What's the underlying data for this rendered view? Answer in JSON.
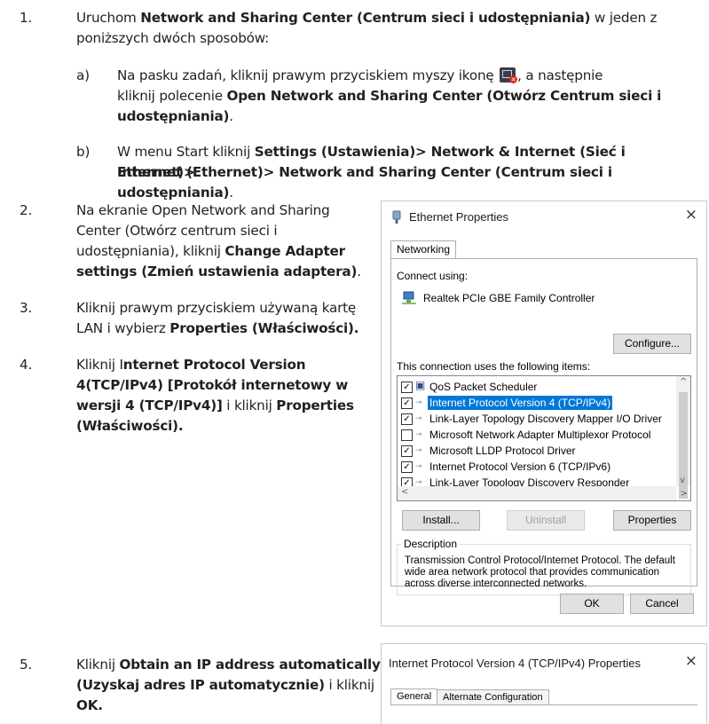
{
  "step1": {
    "num": "1.",
    "pre": "Uruchom ",
    "bold": "Network and Sharing Center (Centrum sieci i udostępniania)",
    "post": " w jeden z",
    "line2": "poniższych dwóch sposobów:"
  },
  "step1a": {
    "label": "a)",
    "pre": "Na pasku zadań, kliknij prawym przyciskiem myszy ikonę ",
    "post": ", a następnie",
    "line2_pre": "kliknij polecenie ",
    "line2_bold": "Open Network and Sharing Center (Otwórz Centrum sieci i",
    "line3_bold": "udostępniania)",
    "line3_post": "."
  },
  "step1b": {
    "label": "b)",
    "pre": "W menu Start kliknij ",
    "bold1": "Settings (Ustawienia)> Network & Internet (Sieć i Internet)>",
    "bold2": "Ethernet (Ethernet)> Network and Sharing Center (Centrum sieci i udostępniania)",
    "post": "."
  },
  "step2": {
    "num": "2.",
    "line1": "Na ekranie Open Network and Sharing",
    "line2": "Center (Otwórz centrum sieci i",
    "line3_pre": "udostępniania), kliknij ",
    "line3_bold": "Change Adapter",
    "line4_bold": "settings (Zmień ustawienia adaptera)",
    "line4_post": "."
  },
  "step3": {
    "num": "3.",
    "line1": "Kliknij prawym przyciskiem używaną kartę",
    "line2_pre": "LAN i wybierz ",
    "line2_bold": "Properties (Właściwości)."
  },
  "step4": {
    "num": "4.",
    "line1_pre": "Kliknij I",
    "line1_bold": "nternet Protocol Version",
    "line2_bold": "4(TCP/IPv4) [Protokół internetowy w",
    "line3_bold": "wersji 4 (TCP/IPv4)]",
    "line3_mid": " i kliknij ",
    "line3_bold2": "Properties",
    "line4_bold": "(Właściwości)."
  },
  "step5": {
    "num": "5.",
    "line1_pre": "Kliknij ",
    "line1_bold": "Obtain an IP address automatically",
    "line2_bold": "(Uzyskaj adres IP automatycznie)",
    "line2_post": " i kliknij",
    "line3_bold": "OK."
  },
  "ethernet_dialog": {
    "title": "Ethernet Properties",
    "close": "×",
    "tab": "Networking",
    "connect_using_label": "Connect using:",
    "adapter": "Realtek PCIe GBE Family Controller",
    "configure_btn": "Configure...",
    "items_label": "This connection uses the following items:",
    "items": [
      {
        "label": "QoS Packet Scheduler",
        "checked": "✓",
        "selected": false
      },
      {
        "label": "Internet Protocol Version 4 (TCP/IPv4)",
        "checked": "✓",
        "selected": true
      },
      {
        "label": "Link-Layer Topology Discovery Mapper I/O Driver",
        "checked": "✓",
        "selected": false
      },
      {
        "label": "Microsoft Network Adapter Multiplexor Protocol",
        "checked": "",
        "selected": false
      },
      {
        "label": "Microsoft LLDP Protocol Driver",
        "checked": "✓",
        "selected": false
      },
      {
        "label": "Internet Protocol Version 6 (TCP/IPv6)",
        "checked": "✓",
        "selected": false
      },
      {
        "label": "Link-Layer Topology Discovery Responder",
        "checked": "✓",
        "selected": false
      }
    ],
    "install_btn": "Install...",
    "uninstall_btn": "Uninstall",
    "properties_btn": "Properties",
    "description_label": "Description",
    "description_text_1": "Transmission Control Protocol/Internet Protocol. The default",
    "description_text_2": "wide area network protocol that provides communication",
    "description_text_3": "across diverse interconnected networks.",
    "ok_btn": "OK",
    "cancel_btn": "Cancel"
  },
  "ipv4_dialog": {
    "title": "Internet Protocol Version 4 (TCP/IPv4) Properties",
    "close": "×",
    "tab_general": "General",
    "tab_alternate": "Alternate Configuration"
  },
  "colors": {
    "text": "#231f20",
    "selection": "#0078d7",
    "close_badge": "#e2231a"
  },
  "icons": {
    "taskbar": "network-error-icon",
    "adapter": "network-adapter-icon",
    "qos": "qos-scheduler-icon",
    "protocol": "protocol-icon"
  }
}
